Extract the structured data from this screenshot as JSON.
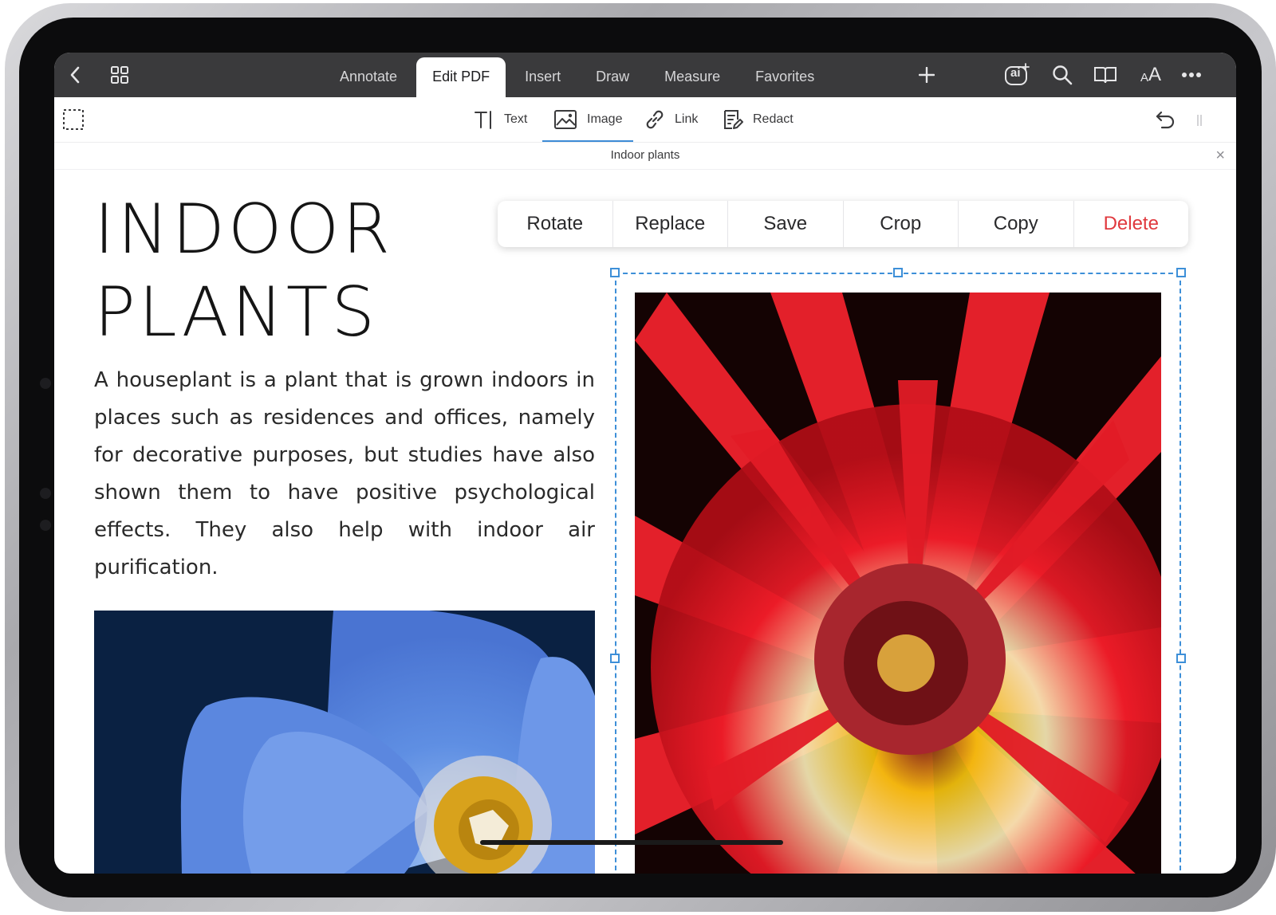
{
  "toolbar": {
    "tabs": [
      {
        "label": "Annotate",
        "active": false
      },
      {
        "label": "Edit PDF",
        "active": true
      },
      {
        "label": "Insert",
        "active": false
      },
      {
        "label": "Draw",
        "active": false
      },
      {
        "label": "Measure",
        "active": false
      },
      {
        "label": "Favorites",
        "active": false
      }
    ],
    "ai_label": "ai",
    "font_size_label": "AA"
  },
  "edit_tools": [
    {
      "label": "Text",
      "icon": "text-cursor-icon"
    },
    {
      "label": "Image",
      "icon": "image-icon",
      "active": true
    },
    {
      "label": "Link",
      "icon": "link-icon"
    },
    {
      "label": "Redact",
      "icon": "redact-icon"
    }
  ],
  "document": {
    "title": "Indoor plants",
    "heading_line1": "INDOOR",
    "heading_line2": "PLANTS",
    "paragraph": "A houseplant is a plant that is grown indoors in places such as residences and offices, namely for decorative purposes, but studies have also shown them to have positive psychological effects. They also help with indoor air purification."
  },
  "context_menu": {
    "items": [
      "Rotate",
      "Replace",
      "Save",
      "Crop",
      "Copy",
      "Delete"
    ],
    "delete_color": "#e0393e"
  },
  "colors": {
    "toolbar_bg": "#3a3a3c",
    "selection": "#3d8fd8",
    "accent": "#3d8bd6"
  }
}
